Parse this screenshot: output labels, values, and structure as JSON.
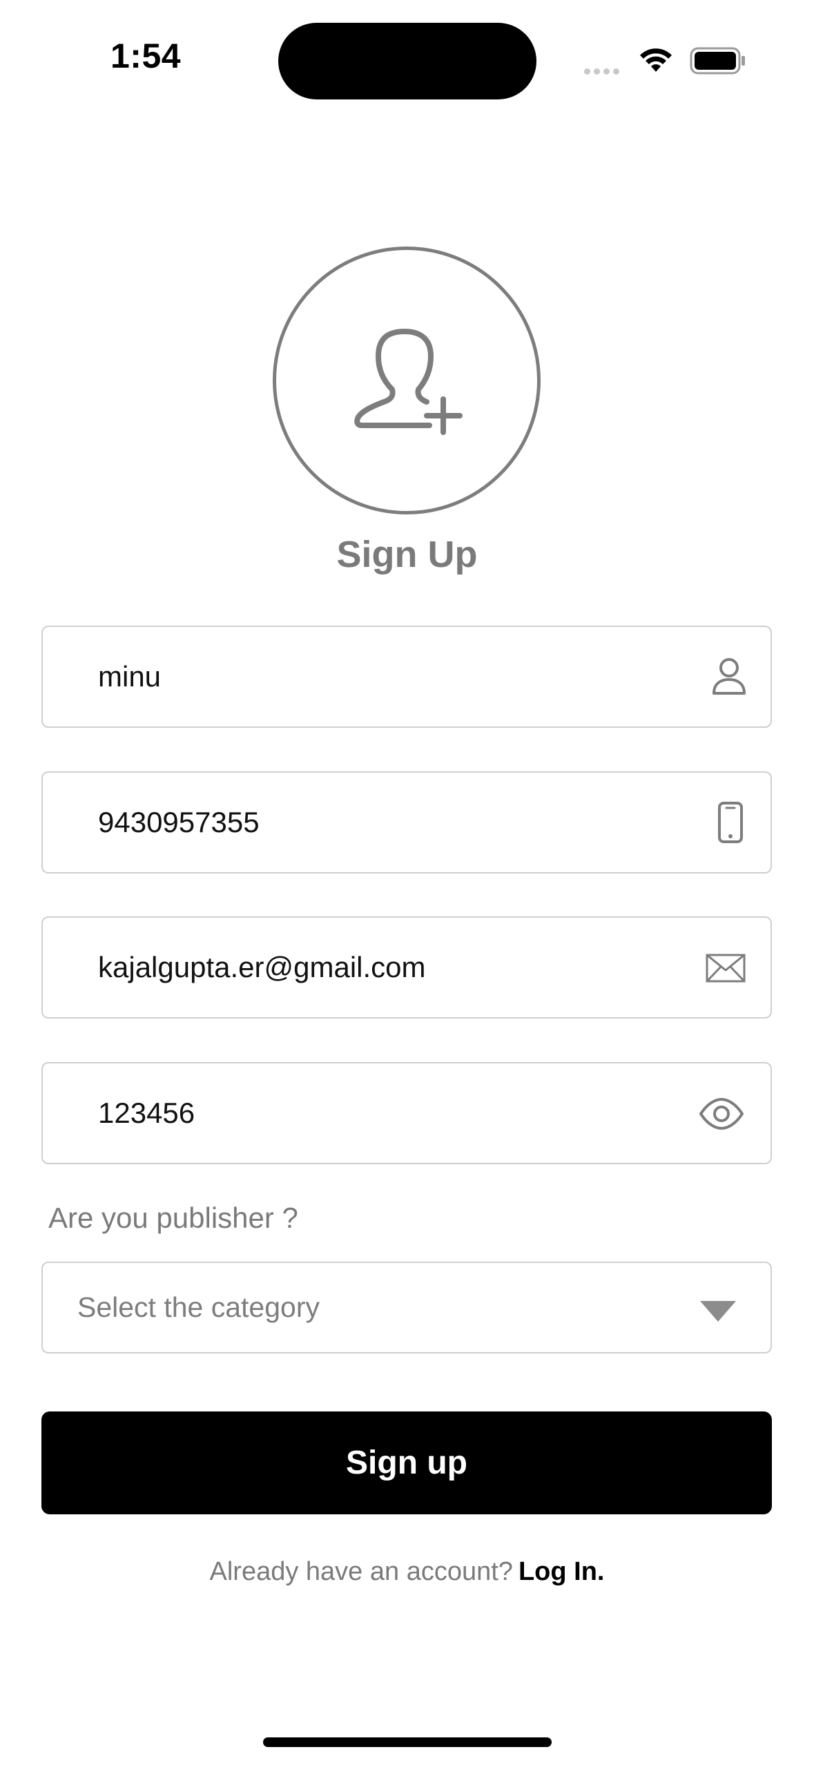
{
  "status_bar": {
    "time": "1:54"
  },
  "header": {
    "title": "Sign Up",
    "avatar_icon": "add-user-icon"
  },
  "form": {
    "name": {
      "value": "minu",
      "icon": "person-icon"
    },
    "phone": {
      "value": "9430957355",
      "icon": "phone-icon"
    },
    "email": {
      "value": "kajalgupta.er@gmail.com",
      "icon": "envelope-icon"
    },
    "password": {
      "value": "123456",
      "icon": "eye-icon"
    },
    "publisher_question": "Are you publisher ?",
    "category": {
      "placeholder": "Select the category",
      "icon": "triangle-down-icon"
    },
    "submit_label": "Sign up"
  },
  "footer": {
    "prompt": "Already have an account?",
    "login_label": "Log In."
  },
  "colors": {
    "primary_button": "#000000",
    "muted_text": "#7a7a7a",
    "field_border": "#cfcfcf"
  }
}
